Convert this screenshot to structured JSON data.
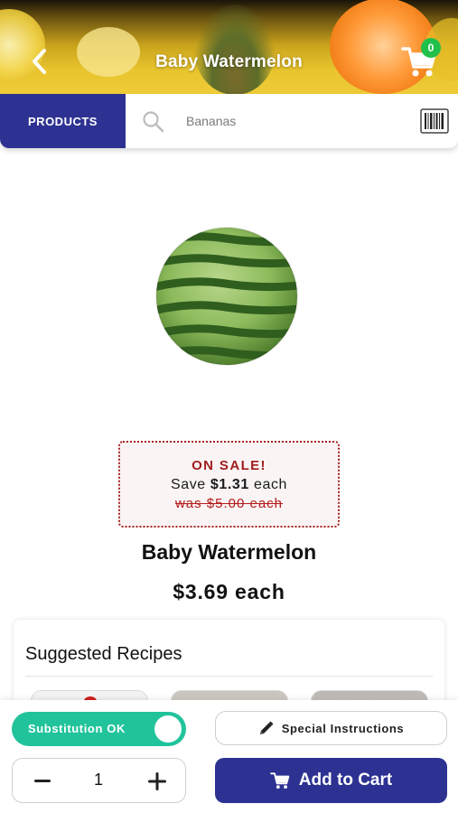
{
  "header": {
    "title": "Baby Watermelon",
    "back_icon": "chevron-left-icon",
    "cart_icon": "shopping-cart-icon",
    "cart_count": "0"
  },
  "search": {
    "products_label": "PRODUCTS",
    "placeholder": "Bananas",
    "search_icon": "search-icon",
    "barcode_icon": "barcode-icon"
  },
  "product": {
    "name": "Baby Watermelon",
    "price": "$3.69 each",
    "sale": {
      "title": "ON SALE!",
      "save_prefix": "Save",
      "save_amount": "$1.31",
      "save_suffix": "each",
      "was": "was $5.00 each"
    }
  },
  "recipes": {
    "title": "Suggested Recipes"
  },
  "bottom": {
    "substitution_label": "Substitution OK",
    "substitution_on": true,
    "special_label": "Special Instructions",
    "special_icon": "pencil-icon",
    "quantity": "1",
    "add_to_cart_label": "Add to Cart",
    "add_to_cart_icon": "shopping-cart-icon"
  },
  "colors": {
    "primary": "#2d3292",
    "toggle": "#21c39b",
    "badge": "#21c04d",
    "sale_red": "#a52222"
  }
}
